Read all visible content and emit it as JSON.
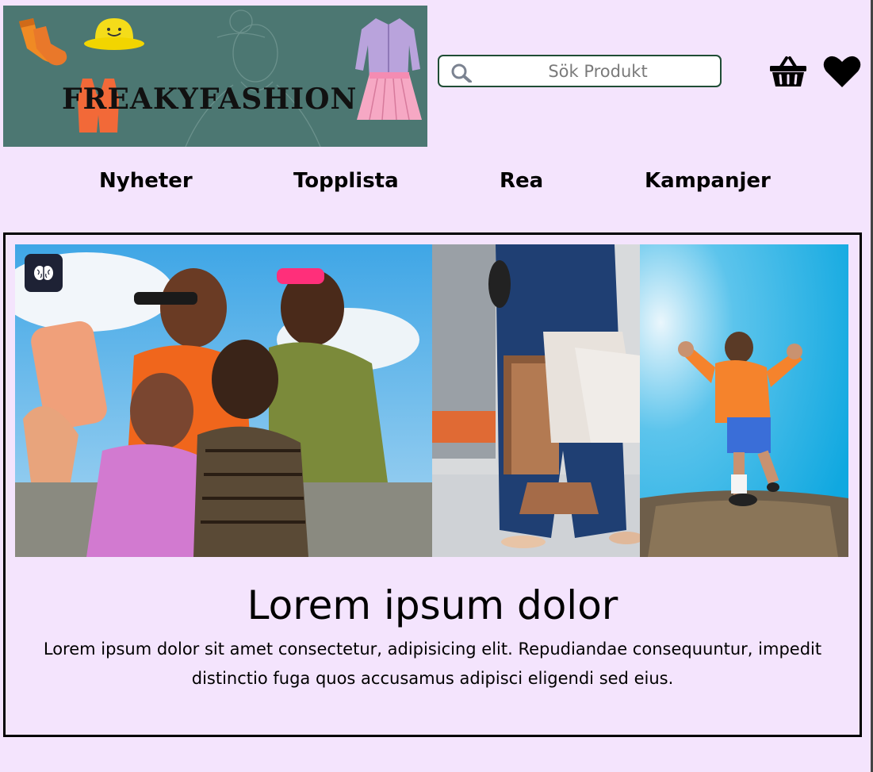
{
  "brand": {
    "logo_text": "FREAKYFASHION",
    "logo_background": "#4c7772"
  },
  "search": {
    "placeholder": "Sök Produkt",
    "icon": "search-icon"
  },
  "header_icons": [
    "basket-icon",
    "heart-icon"
  ],
  "nav": {
    "items": [
      {
        "label": "Nyheter"
      },
      {
        "label": "Topplista"
      },
      {
        "label": "Rea"
      },
      {
        "label": "Kampanjer"
      }
    ]
  },
  "hero": {
    "images": [
      {
        "name": "friends-selfie-image"
      },
      {
        "name": "shopping-bags-image"
      },
      {
        "name": "jumping-man-image"
      }
    ],
    "badge_icon": "brain-icon",
    "title": "Lorem ipsum dolor",
    "text": "Lorem ipsum dolor sit amet consectetur, adipisicing elit. Repudiandae consequuntur, impedit distinctio fuga quos accusamus adipisci eligendi sed eius."
  },
  "colors": {
    "page_background": "#f4e4fd",
    "search_border": "#1f4d35",
    "hero_border": "#000000"
  }
}
